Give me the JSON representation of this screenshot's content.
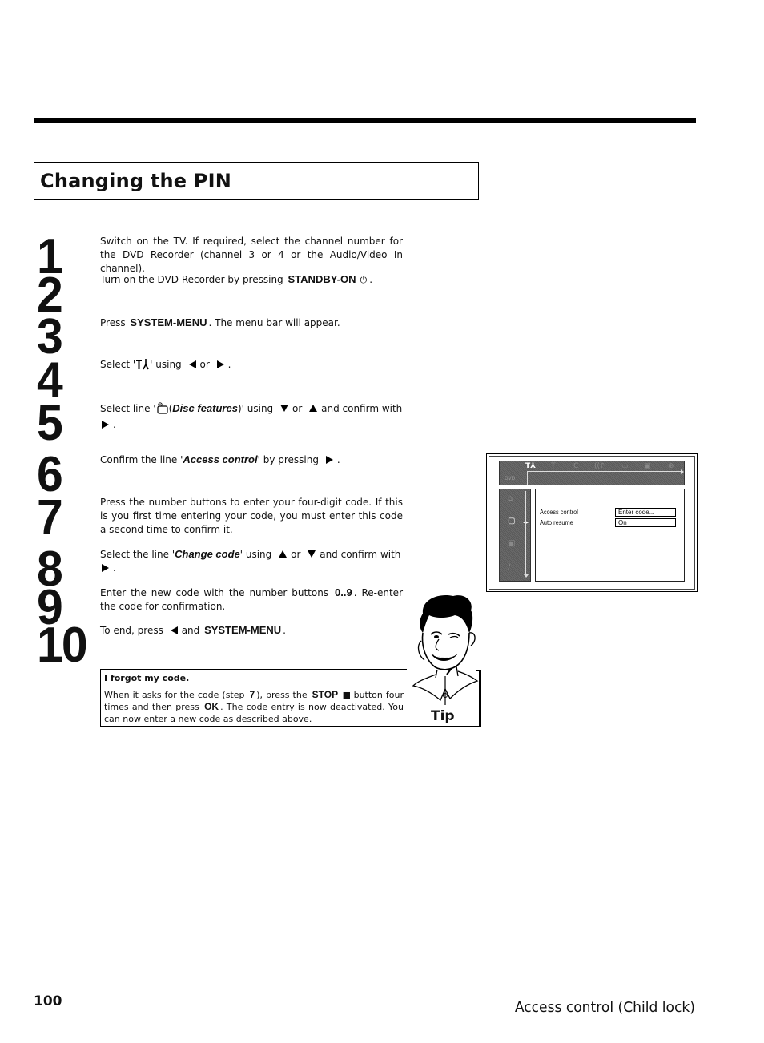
{
  "page": {
    "title": "Changing the PIN",
    "page_number": "100",
    "section_footer": "Access control (Child lock)"
  },
  "steps": [
    {
      "number": "1",
      "text": "Switch on the TV. If required, select the channel number for the DVD Recorder (channel 3 or 4 or the Audio/Video In channel)."
    },
    {
      "number": "2",
      "pre": "Turn on the DVD Recorder by pressing",
      "key": "STANDBY-ON",
      "icon": "power-icon",
      "post": "."
    },
    {
      "number": "3",
      "pre": "Press",
      "key": "SYSTEM-MENU",
      "post": ". The menu bar will appear."
    },
    {
      "number": "4",
      "pre": "Select '",
      "icon": "settings-tools-icon",
      "mid": "' using",
      "or": "or",
      "post": "."
    },
    {
      "number": "5",
      "pre": "Select line '",
      "icon": "disc-features-icon",
      "label": "Disc features",
      "mid": ")' using",
      "or": "or",
      "and_confirm": "and confirm with",
      "post": "."
    },
    {
      "number": "6",
      "pre": "Confirm the line '",
      "label": "Access control",
      "mid": "' by pressing",
      "post": "."
    },
    {
      "number": "7",
      "text": "Press the number buttons to enter your four-digit code. If this is you first time entering your code, you must enter this code a second time to confirm it."
    },
    {
      "number": "8",
      "pre": "Select the line '",
      "label": "Change code",
      "mid": "' using",
      "or": "or",
      "and_confirm": "and confirm with",
      "post": "."
    },
    {
      "number": "9",
      "pre": "Enter the new code with the number buttons",
      "key": "0..9",
      "post": ". Re-enter the code for confirmation."
    },
    {
      "number": "10",
      "pre": "To end, press",
      "and": "and",
      "key": "SYSTEM-MENU",
      "post": "."
    }
  ],
  "tip": {
    "label": "Tip",
    "title": "I forgot my code.",
    "body_1": "When it asks for the code (step",
    "step_ref": "7",
    "body_2": "), press the",
    "key_stop": "STOP",
    "body_3": "button four times and then press",
    "key_ok": "OK",
    "body_4": ". The code entry is now deactivated. You can now enter a new code as described above."
  },
  "osd": {
    "topbar_icons": [
      "settings-tools-icon",
      "title-icon",
      "chapter-icon",
      "audio-icon",
      "subtitle-icon",
      "camera-angle-icon",
      "zoom-icon"
    ],
    "topbar_glyphs": [
      "T⅄",
      "T",
      "C",
      "((♪",
      "▭",
      "▣",
      "⊕"
    ],
    "dvd_label": "DVD",
    "sidebar_icons": [
      "lock-icon",
      "disc-features-icon",
      "display-icon",
      "tools-icon"
    ],
    "sidebar_glyphs": [
      "⌂",
      "▢",
      "▣",
      "∕"
    ],
    "selection_marker": "◂▸",
    "rows": [
      {
        "label": "Access control",
        "value": "Enter code..."
      },
      {
        "label": "Auto resume",
        "value": "On"
      }
    ]
  }
}
